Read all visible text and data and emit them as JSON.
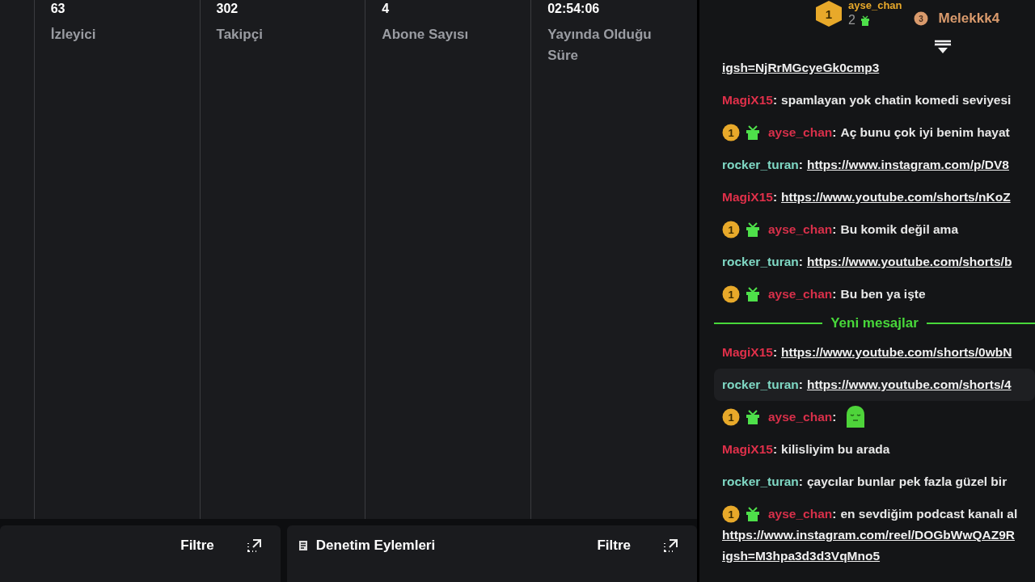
{
  "stats": [
    {
      "value": "63",
      "label": "İzleyici"
    },
    {
      "value": "302",
      "label": "Takipçi"
    },
    {
      "value": "4",
      "label": "Abone Sayısı"
    },
    {
      "value": "02:54:06",
      "label": "Yayında Olduğu Süre"
    }
  ],
  "panels": [
    {
      "filter": "Filtre"
    },
    {
      "title": "Denetim Eylemleri",
      "filter": "Filtre"
    }
  ],
  "leaderboard": [
    {
      "rank": "1",
      "name": "ayse_chan",
      "gifts": "2",
      "color": "#e8a92a"
    },
    {
      "rank": "3",
      "name": "Melekkk4",
      "color": "#d99a6c"
    }
  ],
  "chat_separator": ":",
  "chat": [
    {
      "kind": "continuation",
      "lines": [
        "igsh=NjRrMGcyeGk0cmp3"
      ]
    },
    {
      "kind": "text",
      "user": "MagiX15",
      "color": "#e0304a",
      "badges": false,
      "highlighted": false,
      "text": "spamlayan yok chatin komedi seviyesi"
    },
    {
      "kind": "text",
      "user": "ayse_chan",
      "color": "#d8304a",
      "badges": true,
      "badge_rank": "1",
      "highlighted": false,
      "text": "Aç bunu çok iyi benim hayat"
    },
    {
      "kind": "link",
      "user": "rocker_turan",
      "color": "#7fd8c4",
      "badges": false,
      "highlighted": false,
      "lines": [
        "https://www.instagram.com/p/DV8"
      ]
    },
    {
      "kind": "link",
      "user": "MagiX15",
      "color": "#e0304a",
      "badges": false,
      "highlighted": false,
      "lines": [
        "https://www.youtube.com/shorts/nKoZ"
      ]
    },
    {
      "kind": "text",
      "user": "ayse_chan",
      "color": "#d8304a",
      "badges": true,
      "badge_rank": "1",
      "highlighted": false,
      "text": "Bu komik değil ama"
    },
    {
      "kind": "link",
      "user": "rocker_turan",
      "color": "#7fd8c4",
      "badges": false,
      "highlighted": false,
      "lines": [
        "https://www.youtube.com/shorts/b"
      ]
    },
    {
      "kind": "text",
      "user": "ayse_chan",
      "color": "#d8304a",
      "badges": true,
      "badge_rank": "1",
      "highlighted": false,
      "text": "Bu ben ya işte"
    },
    {
      "kind": "divider",
      "text": "Yeni mesajlar"
    },
    {
      "kind": "link",
      "user": "MagiX15",
      "color": "#e0304a",
      "badges": false,
      "highlighted": false,
      "lines": [
        "https://www.youtube.com/shorts/0wbN"
      ]
    },
    {
      "kind": "link",
      "user": "rocker_turan",
      "color": "#7fd8c4",
      "badges": false,
      "highlighted": true,
      "lines": [
        "https://www.youtube.com/shorts/4"
      ]
    },
    {
      "kind": "emote",
      "user": "ayse_chan",
      "color": "#d8304a",
      "badges": true,
      "badge_rank": "1",
      "highlighted": false
    },
    {
      "kind": "text",
      "user": "MagiX15",
      "color": "#e0304a",
      "badges": false,
      "highlighted": false,
      "text": "kilisliyim bu arada"
    },
    {
      "kind": "text",
      "user": "rocker_turan",
      "color": "#7fd8c4",
      "badges": false,
      "highlighted": false,
      "text": "çaycılar bunlar pek fazla güzel bir"
    },
    {
      "kind": "text",
      "user": "ayse_chan",
      "color": "#d8304a",
      "badges": true,
      "badge_rank": "1",
      "highlighted": false,
      "text": "en sevdiğim podcast kanalı al",
      "lines": [
        "https://www.instagram.com/reel/DOGbWwQAZ9R",
        "igsh=M3hpa3d3d3VqMno5"
      ]
    }
  ]
}
